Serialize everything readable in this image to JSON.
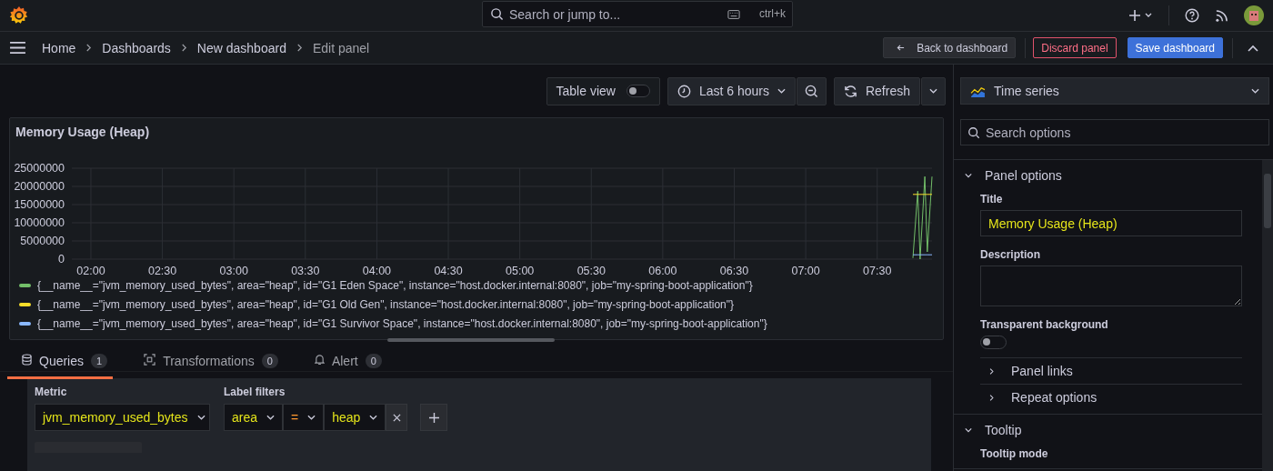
{
  "top_bar": {
    "search": {
      "placeholder": "Search or jump to...",
      "shortcut": "ctrl+k"
    }
  },
  "breadcrumbs": [
    {
      "label": "Home",
      "current": false
    },
    {
      "label": "Dashboards",
      "current": false
    },
    {
      "label": "New dashboard",
      "current": false
    },
    {
      "label": "Edit panel",
      "current": true
    }
  ],
  "actions": {
    "back": "Back to dashboard",
    "discard": "Discard panel",
    "save": "Save dashboard"
  },
  "toolbar": {
    "table_view": {
      "label": "Table view",
      "on": false
    },
    "time_range": "Last 6 hours",
    "refresh": "Refresh"
  },
  "panel": {
    "title": "Memory Usage (Heap)",
    "chart_data": {
      "type": "line",
      "grid": true,
      "x": [
        465,
        467,
        468,
        470,
        471,
        473
      ],
      "xlim": [
        112,
        473
      ],
      "ylim": [
        0,
        25000000
      ],
      "xticks": [
        {
          "value": 120,
          "label": "02:00"
        },
        {
          "value": 150,
          "label": "02:30"
        },
        {
          "value": 180,
          "label": "03:00"
        },
        {
          "value": 210,
          "label": "03:30"
        },
        {
          "value": 240,
          "label": "04:00"
        },
        {
          "value": 270,
          "label": "04:30"
        },
        {
          "value": 300,
          "label": "05:00"
        },
        {
          "value": 330,
          "label": "05:30"
        },
        {
          "value": 360,
          "label": "06:00"
        },
        {
          "value": 390,
          "label": "06:30"
        },
        {
          "value": 420,
          "label": "07:00"
        },
        {
          "value": 450,
          "label": "07:30"
        }
      ],
      "yticks": [
        0,
        5000000,
        10000000,
        15000000,
        20000000,
        25000000
      ],
      "series": [
        {
          "color": "#73bf69",
          "values": [
            300000,
            18700000,
            0,
            22700000,
            2000000,
            22700000
          ]
        },
        {
          "color": "#fade2a",
          "values": [
            17800000,
            17800000,
            17800000,
            17800000,
            17800000,
            17800000
          ]
        },
        {
          "color": "#8ab8ff",
          "values": [
            1200000,
            1200000,
            1200000,
            1200000,
            1200000,
            1200000
          ]
        }
      ]
    },
    "legend": [
      {
        "label": "{__name__=\"jvm_memory_used_bytes\", area=\"heap\", id=\"G1 Eden Space\", instance=\"host.docker.internal:8080\", job=\"my-spring-boot-application\"}",
        "color": "#73bf69"
      },
      {
        "label": "{__name__=\"jvm_memory_used_bytes\", area=\"heap\", id=\"G1 Old Gen\", instance=\"host.docker.internal:8080\", job=\"my-spring-boot-application\"}",
        "color": "#fade2a"
      },
      {
        "label": "{__name__=\"jvm_memory_used_bytes\", area=\"heap\", id=\"G1 Survivor Space\", instance=\"host.docker.internal:8080\", job=\"my-spring-boot-application\"}",
        "color": "#8ab8ff"
      }
    ]
  },
  "query_tabs": [
    {
      "label": "Queries",
      "count": "1",
      "selected": true,
      "kind": "database"
    },
    {
      "label": "Transformations",
      "count": "0",
      "selected": false,
      "kind": "transform"
    },
    {
      "label": "Alert",
      "count": "0",
      "selected": false,
      "kind": "bell"
    }
  ],
  "query": {
    "metric_label": "Metric",
    "metric": "jvm_memory_used_bytes",
    "filters_label": "Label filters",
    "filter": {
      "label": "area",
      "operator": "=",
      "value": "heap"
    }
  },
  "options": {
    "visualization": "Time series",
    "search": {
      "placeholder": "Search options"
    },
    "sections": [
      {
        "title": "Panel options",
        "expanded": true,
        "items": [
          {
            "kind": "input",
            "label": "Title",
            "value": "Memory Usage (Heap)"
          },
          {
            "kind": "textarea",
            "label": "Description"
          },
          {
            "kind": "switch",
            "label": "Transparent background",
            "on": false
          },
          {
            "kind": "group",
            "label": "Panel links",
            "expanded": false
          },
          {
            "kind": "group",
            "label": "Repeat options",
            "expanded": false
          }
        ]
      },
      {
        "title": "Tooltip",
        "expanded": true,
        "items": [
          {
            "kind": "heading",
            "label": "Tooltip mode"
          }
        ]
      }
    ]
  }
}
